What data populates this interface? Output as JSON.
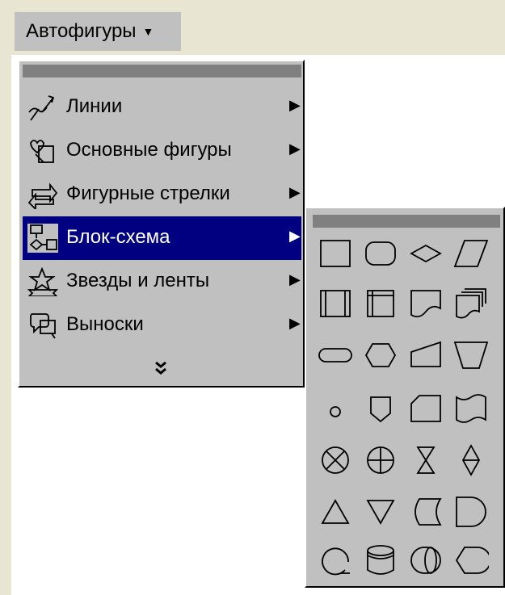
{
  "toolbar": {
    "autoshapes_label": "Автофигуры",
    "dropdown_icon": "triangle-down-icon"
  },
  "menu": {
    "items": [
      {
        "label": "Линии",
        "icon": "lines-icon",
        "has_submenu": true
      },
      {
        "label": "Основные фигуры",
        "icon": "basic-shapes-icon",
        "has_submenu": true
      },
      {
        "label": "Фигурные стрелки",
        "icon": "block-arrows-icon",
        "has_submenu": true
      },
      {
        "label": "Блок-схема",
        "icon": "flowchart-icon",
        "has_submenu": true,
        "selected": true
      },
      {
        "label": "Звезды и ленты",
        "icon": "stars-banners-icon",
        "has_submenu": true
      },
      {
        "label": "Выноски",
        "icon": "callouts-icon",
        "has_submenu": true
      }
    ],
    "expand_icon": "double-chevron-down-icon"
  },
  "submenu_arrow": "▶",
  "palette": {
    "shapes": [
      "process-shape",
      "alternate-process-shape",
      "decision-shape",
      "data-shape",
      "predefined-process-shape",
      "internal-storage-shape",
      "document-shape",
      "multidocument-shape",
      "terminator-shape",
      "preparation-shape",
      "manual-input-shape",
      "manual-operation-shape",
      "connector-shape",
      "offpage-connector-shape",
      "card-shape",
      "punched-tape-shape",
      "summing-junction-shape",
      "or-shape",
      "collate-shape",
      "sort-shape",
      "extract-shape",
      "merge-shape",
      "stored-data-shape",
      "delay-shape",
      "sequential-access-storage-shape",
      "magnetic-disk-shape",
      "direct-access-storage-shape",
      "display-shape"
    ]
  },
  "colors": {
    "menu_bg": "#c0c0c0",
    "selection": "#000080",
    "drag_bar": "#808080",
    "desktop": "#e8e6d3"
  }
}
